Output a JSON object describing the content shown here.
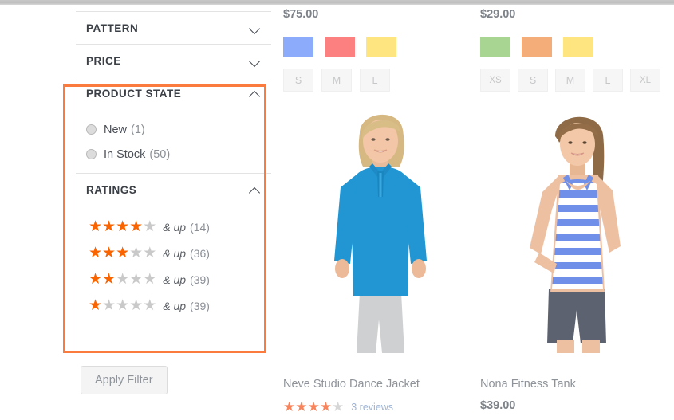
{
  "sidebar": {
    "sections": [
      {
        "title": "PATTERN",
        "expanded": false,
        "chevron": "chevron-down-icon"
      },
      {
        "title": "PRICE",
        "expanded": false,
        "chevron": "chevron-down-icon"
      },
      {
        "title": "PRODUCT STATE",
        "expanded": true,
        "chevron": "chevron-up-icon"
      },
      {
        "title": "RATINGS",
        "expanded": true,
        "chevron": "chevron-up-icon"
      }
    ],
    "product_state": {
      "title": "PRODUCT STATE",
      "options": [
        {
          "label": "New",
          "count": "(1)",
          "selected": false
        },
        {
          "label": "In Stock",
          "count": "(50)",
          "selected": false
        }
      ]
    },
    "ratings": {
      "title": "RATINGS",
      "and_up_label": "& up",
      "rows": [
        {
          "filled": 4,
          "total": 5,
          "count": "(14)"
        },
        {
          "filled": 3,
          "total": 5,
          "count": "(36)"
        },
        {
          "filled": 2,
          "total": 5,
          "count": "(39)"
        },
        {
          "filled": 1,
          "total": 5,
          "count": "(39)"
        }
      ]
    },
    "apply_filter_label": "Apply Filter",
    "highlight_color": "#fb7b3f",
    "star_color": "#fa6400",
    "star_empty_color": "#c9c9c9"
  },
  "products": [
    {
      "price_top": "$75.00",
      "name": "Neve Studio Dance Jacket",
      "swatches": [
        "#8cabfa",
        "#fd8080",
        "#ffe57f"
      ],
      "sizes": [
        "S",
        "M",
        "L"
      ],
      "rating_filled": 4,
      "rating_total": 5,
      "reviews_label": "3 reviews",
      "price_bottom": null
    },
    {
      "price_top": "$29.00",
      "name": "Nona Fitness Tank",
      "swatches": [
        "#a8d592",
        "#f4ad78",
        "#ffe57f"
      ],
      "sizes": [
        "XS",
        "S",
        "M",
        "L",
        "XL"
      ],
      "rating_filled": 0,
      "rating_total": 0,
      "reviews_label": null,
      "price_bottom": "$39.00"
    }
  ],
  "icons": {
    "star": "★"
  }
}
